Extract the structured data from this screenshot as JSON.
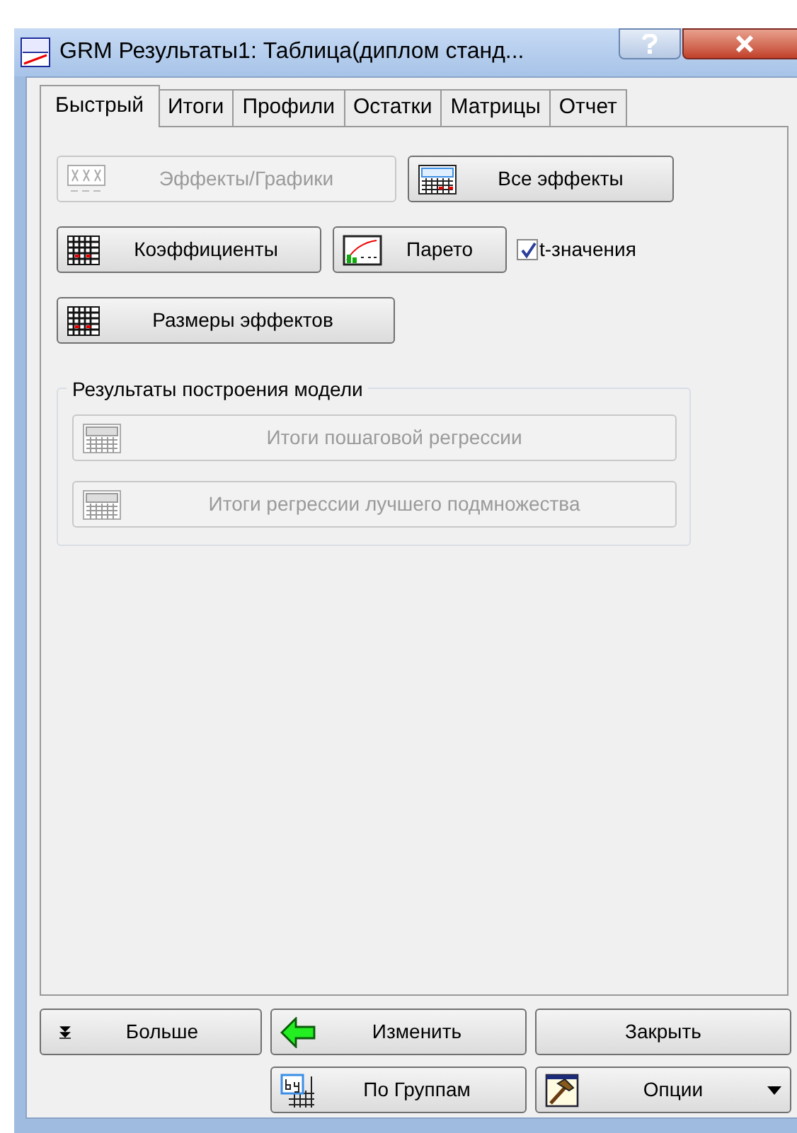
{
  "window": {
    "title": "GRM Результаты1: Таблица(диплом станд..."
  },
  "tabs": [
    {
      "label": "Быстрый",
      "selected": true
    },
    {
      "label": "Итоги",
      "selected": false
    },
    {
      "label": "Профили",
      "selected": false
    },
    {
      "label": "Остатки",
      "selected": false
    },
    {
      "label": "Матрицы",
      "selected": false
    },
    {
      "label": "Отчет",
      "selected": false
    }
  ],
  "quick_rows": [
    [
      {
        "label": "Эффекты/Графики",
        "disabled": true
      },
      {
        "label": "Все эффекты",
        "disabled": false
      }
    ],
    [
      {
        "label": "Коэффициенты",
        "disabled": false
      },
      {
        "label": "Парето",
        "disabled": false
      },
      {
        "kind": "checkbox",
        "label": "t-значения",
        "checked": true
      }
    ],
    [
      {
        "label": "Размеры эффектов",
        "disabled": false
      }
    ]
  ],
  "model_group": {
    "title": "Результаты построения модели",
    "buttons": [
      {
        "label": "Итоги пошаговой регрессии",
        "disabled": true
      },
      {
        "label": "Итоги регрессии лучшего подмножества",
        "disabled": true
      }
    ]
  },
  "bottom_buttons": [
    {
      "label": "Больше"
    },
    {
      "label": "Изменить"
    },
    {
      "label": "Закрыть"
    },
    {
      "label": "По Группам"
    },
    {
      "label": "Опции",
      "dropdown": true
    }
  ]
}
